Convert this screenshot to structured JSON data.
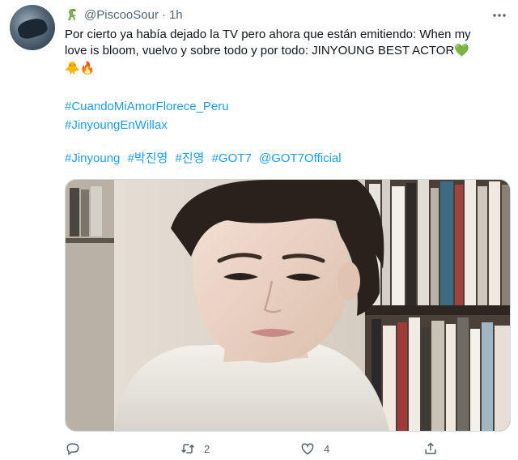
{
  "user": {
    "handle": "@PiscooSour",
    "time": "1h",
    "separator": "·"
  },
  "tweet": {
    "text_line1": "Por cierto ya había dejado la TV pero ahora que están emitiendo: When my",
    "text_line2": "love is bloom, vuelvo y sobre todo y por todo: JINYOUNG BEST ACTOR",
    "emoji_heart": "💚",
    "emoji_chick": "🐥",
    "emoji_fire": "🔥",
    "hashtags_1": [
      "#CuandoMiAmorFlorece_Peru"
    ],
    "hashtags_2": [
      "#JinyoungEnWillax"
    ],
    "hashtags_3": [
      "#Jinyoung",
      "#박진영",
      "#진영",
      "#GOT7",
      "@GOT7Official"
    ]
  },
  "actions": {
    "reply_count": "",
    "retweet_count": "2",
    "like_count": "4"
  },
  "icons": {
    "name_emoji": "dino-icon",
    "more": "more-icon",
    "reply": "reply-icon",
    "retweet": "retweet-icon",
    "like": "like-icon",
    "share": "share-icon"
  },
  "colors": {
    "link": "#1d9bf0",
    "muted": "#536471",
    "text": "#0f1419",
    "accent_green": "#78b159"
  }
}
